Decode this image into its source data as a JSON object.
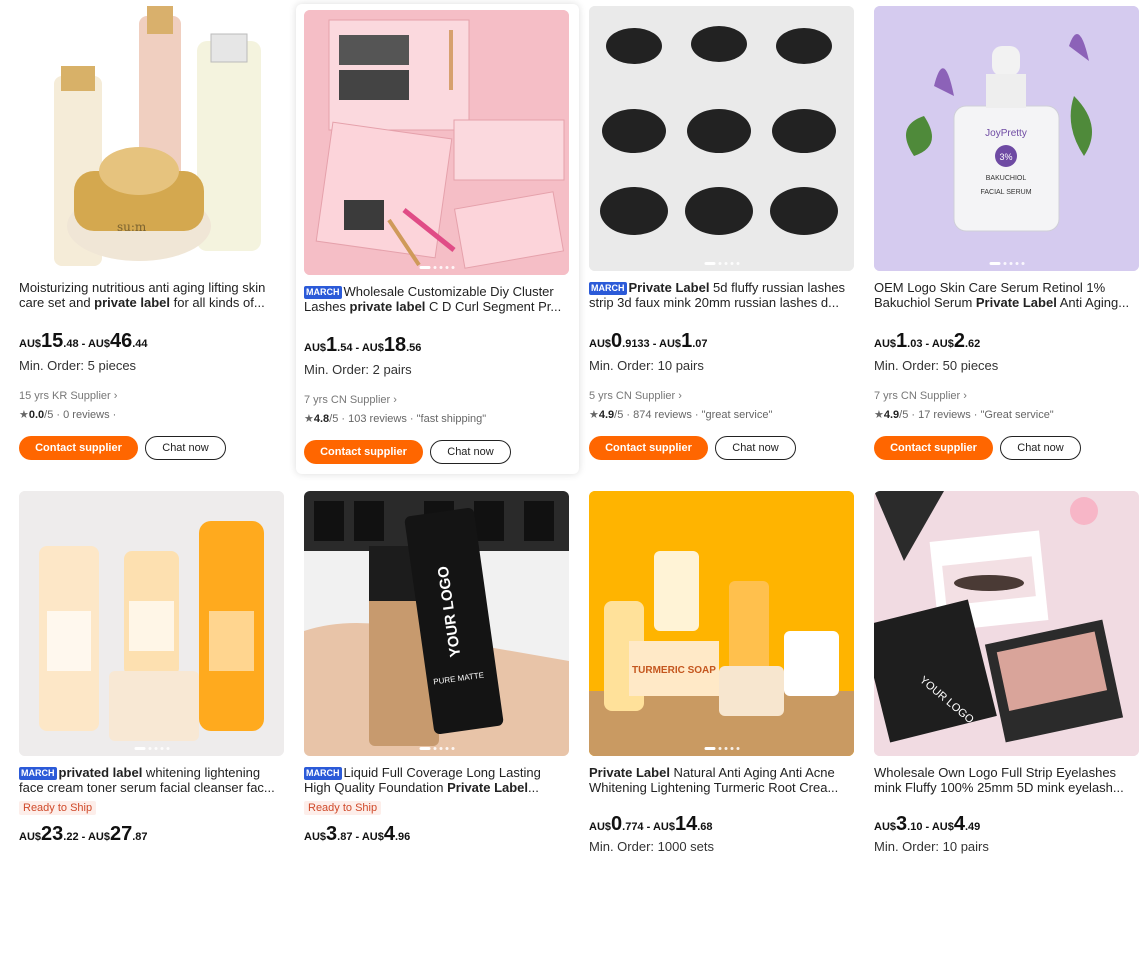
{
  "cards": [
    {
      "title_pre": "",
      "badge": "",
      "title_bold": "private label",
      "title_a": "Moisturizing nutritious anti aging lifting skin care set and ",
      "title_b": " for all kinds of...",
      "price": {
        "cur1": "AU$",
        "int1": "15",
        "dec1": ".48",
        "sep": " - ",
        "cur2": "AU$",
        "int2": "46",
        "dec2": ".44"
      },
      "min_order": "Min. Order: 5 pieces",
      "supplier": "15 yrs KR Supplier ›",
      "rating_value": "0.0",
      "rating_max": "/5",
      "reviews": " · 0 reviews ·",
      "review_tag": "",
      "contact_label": "Contact supplier",
      "chat_label": "Chat now",
      "image": "skincare-bottles-image"
    },
    {
      "badge": "MARCH",
      "title_a": "Wholesale Customizable Diy Cluster Lashes ",
      "title_bold": "private label",
      "title_b": " C D Curl Segment Pr...",
      "price": {
        "cur1": "AU$",
        "int1": "1",
        "dec1": ".54",
        "sep": " - ",
        "cur2": "AU$",
        "int2": "18",
        "dec2": ".56"
      },
      "min_order": "Min. Order: 2 pairs",
      "supplier": "7 yrs CN Supplier ›",
      "rating_value": "4.8",
      "rating_max": "/5",
      "reviews": " · 103 reviews ·",
      "review_tag": " \"fast shipping\"",
      "contact_label": "Contact supplier",
      "chat_label": "Chat now",
      "image": "lash-kit-image"
    },
    {
      "badge": "MARCH",
      "title_a": "",
      "title_bold": "Private Label",
      "title_b": " 5d fluffy russian lashes strip 3d faux mink 20mm russian lashes d...",
      "price": {
        "cur1": "AU$",
        "int1": "0",
        "dec1": ".9133",
        "sep": " - ",
        "cur2": "AU$",
        "int2": "1",
        "dec2": ".07"
      },
      "min_order": "Min. Order: 10 pairs",
      "supplier": "5 yrs CN Supplier ›",
      "rating_value": "4.9",
      "rating_max": "/5",
      "reviews": " · 874 reviews ·",
      "review_tag": " \"great service\"",
      "contact_label": "Contact supplier",
      "chat_label": "Chat now",
      "image": "lash-grid-image"
    },
    {
      "badge": "",
      "title_a": "OEM Logo Skin Care Serum Retinol 1% Bakuchiol Serum ",
      "title_bold": "Private Label",
      "title_b": " Anti Aging...",
      "price": {
        "cur1": "AU$",
        "int1": "1",
        "dec1": ".03",
        "sep": " - ",
        "cur2": "AU$",
        "int2": "2",
        "dec2": ".62"
      },
      "min_order": "Min. Order: 50 pieces",
      "supplier": "7 yrs CN Supplier ›",
      "rating_value": "4.9",
      "rating_max": "/5",
      "reviews": " · 17 reviews ·",
      "review_tag": " \"Great service\"",
      "contact_label": "Contact supplier",
      "chat_label": "Chat now",
      "image": "serum-bottle-image",
      "image_text": {
        "brand": "JoyPretty",
        "pct": "3%",
        "name": "BAKUCHIOL",
        "kind": "FACIAL SERUM"
      }
    },
    {
      "badge": "MARCH",
      "title_a": "",
      "title_bold": "privated label",
      "title_b": " whitening lightening face cream toner serum facial cleanser fac...",
      "ready": "Ready to Ship",
      "price": {
        "cur1": "AU$",
        "int1": "23",
        "dec1": ".22",
        "sep": " - ",
        "cur2": "AU$",
        "int2": "27",
        "dec2": ".87"
      },
      "image": "turmeric-set-image"
    },
    {
      "badge": "MARCH",
      "title_a": "Liquid Full Coverage Long Lasting High Quality Foundation ",
      "title_bold": "Private Label",
      "title_b": "...",
      "ready": "Ready to Ship",
      "price": {
        "cur1": "AU$",
        "int1": "3",
        "dec1": ".87",
        "sep": " - ",
        "cur2": "AU$",
        "int2": "4",
        "dec2": ".96"
      },
      "image": "foundation-image",
      "image_text": {
        "logo": "YOUR LOGO",
        "product": "PURE MATTE"
      }
    },
    {
      "badge": "",
      "title_a": "",
      "title_bold": "Private Label",
      "title_b": " Natural Anti Aging Anti Acne Whitening Lightening Turmeric Root Crea...",
      "price": {
        "cur1": "AU$",
        "int1": "0",
        "dec1": ".774",
        "sep": " - ",
        "cur2": "AU$",
        "int2": "14",
        "dec2": ".68"
      },
      "min_order": "Min. Order: 1000 sets",
      "image": "turmeric-soap-image",
      "image_text": {
        "soap": "TURMERIC SOAP"
      }
    },
    {
      "badge": "",
      "title_a": "Wholesale Own Logo Full Strip Eyelashes mink Fluffy 100% 25mm 5D mink eyelash...",
      "title_bold": "",
      "title_b": "",
      "price": {
        "cur1": "AU$",
        "int1": "3",
        "dec1": ".10",
        "sep": " - ",
        "cur2": "AU$",
        "int2": "4",
        "dec2": ".49"
      },
      "min_order": "Min. Order: 10 pairs",
      "image": "lash-box-image",
      "image_text": {
        "logo": "YOUR LOGO"
      }
    }
  ],
  "colors": {
    "accent": "#ff6600",
    "badge": "#2b5ad8",
    "ready": "#d04a2a"
  }
}
